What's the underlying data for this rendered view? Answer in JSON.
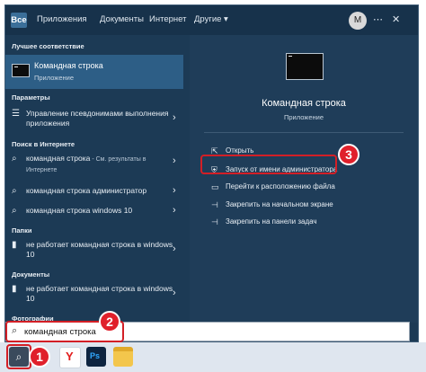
{
  "tabs": [
    "Все",
    "Приложения",
    "Документы",
    "Интернет",
    "Другие ▾"
  ],
  "avatar": "M",
  "topbar_icons": {
    "more": "⋯",
    "close": "✕"
  },
  "left": {
    "best_title": "Лучшее соответствие",
    "best_name": "Командная строка",
    "best_sub": "Приложение",
    "params_title": "Параметры",
    "params_item": "Управление псевдонимами выполнения приложения",
    "web_title": "Поиск в Интернете",
    "web1_main": "командная строка",
    "web1_sub": " - См. результаты в Интернете",
    "web2": "командная строка администратор",
    "web3": "командная строка windows 10",
    "folders_title": "Папки",
    "folder1": "не работает командная строка в windows 10",
    "docs_title": "Документы",
    "doc1": "не работает командная строка в windows 10",
    "photos_title": "Фотографии"
  },
  "right": {
    "app_name": "Командная строка",
    "app_sub": "Приложение",
    "actions": [
      "Открыть",
      "Запуск от имени администратора",
      "Перейти к расположению файла",
      "Закрепить на начальном экране",
      "Закрепить на панели задач"
    ]
  },
  "search": {
    "value": "командная строка"
  },
  "badges": [
    "1",
    "2",
    "3"
  ],
  "colors": {
    "accent": "#2d5e86",
    "highlight": "#d31f26",
    "panel": "#1c3a55"
  }
}
